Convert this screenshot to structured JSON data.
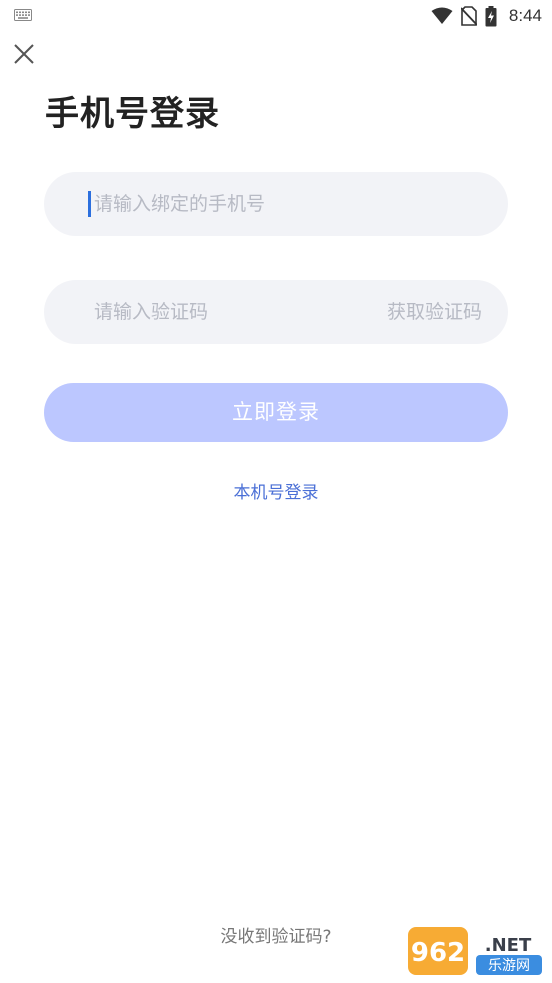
{
  "status_bar": {
    "time": "8:44",
    "icons": [
      "keyboard-icon",
      "wifi-icon",
      "no-sim-icon",
      "battery-charging-icon"
    ]
  },
  "header": {
    "close_icon": "close-icon",
    "title": "手机号登录"
  },
  "form": {
    "phone_placeholder": "请输入绑定的手机号",
    "phone_value": "",
    "code_placeholder": "请输入验证码",
    "code_value": "",
    "get_code_label": "获取验证码",
    "submit_label": "立即登录"
  },
  "links": {
    "local_number_login": "本机号登录",
    "no_code_received": "没收到验证码?"
  },
  "watermark": {
    "brand": "962.NET",
    "subtitle": "乐游网"
  },
  "colors": {
    "accent": "#4a6fd6",
    "button_disabled": "#bcc7ff",
    "field_bg": "#f2f3f7",
    "caret": "#2c6fde"
  }
}
